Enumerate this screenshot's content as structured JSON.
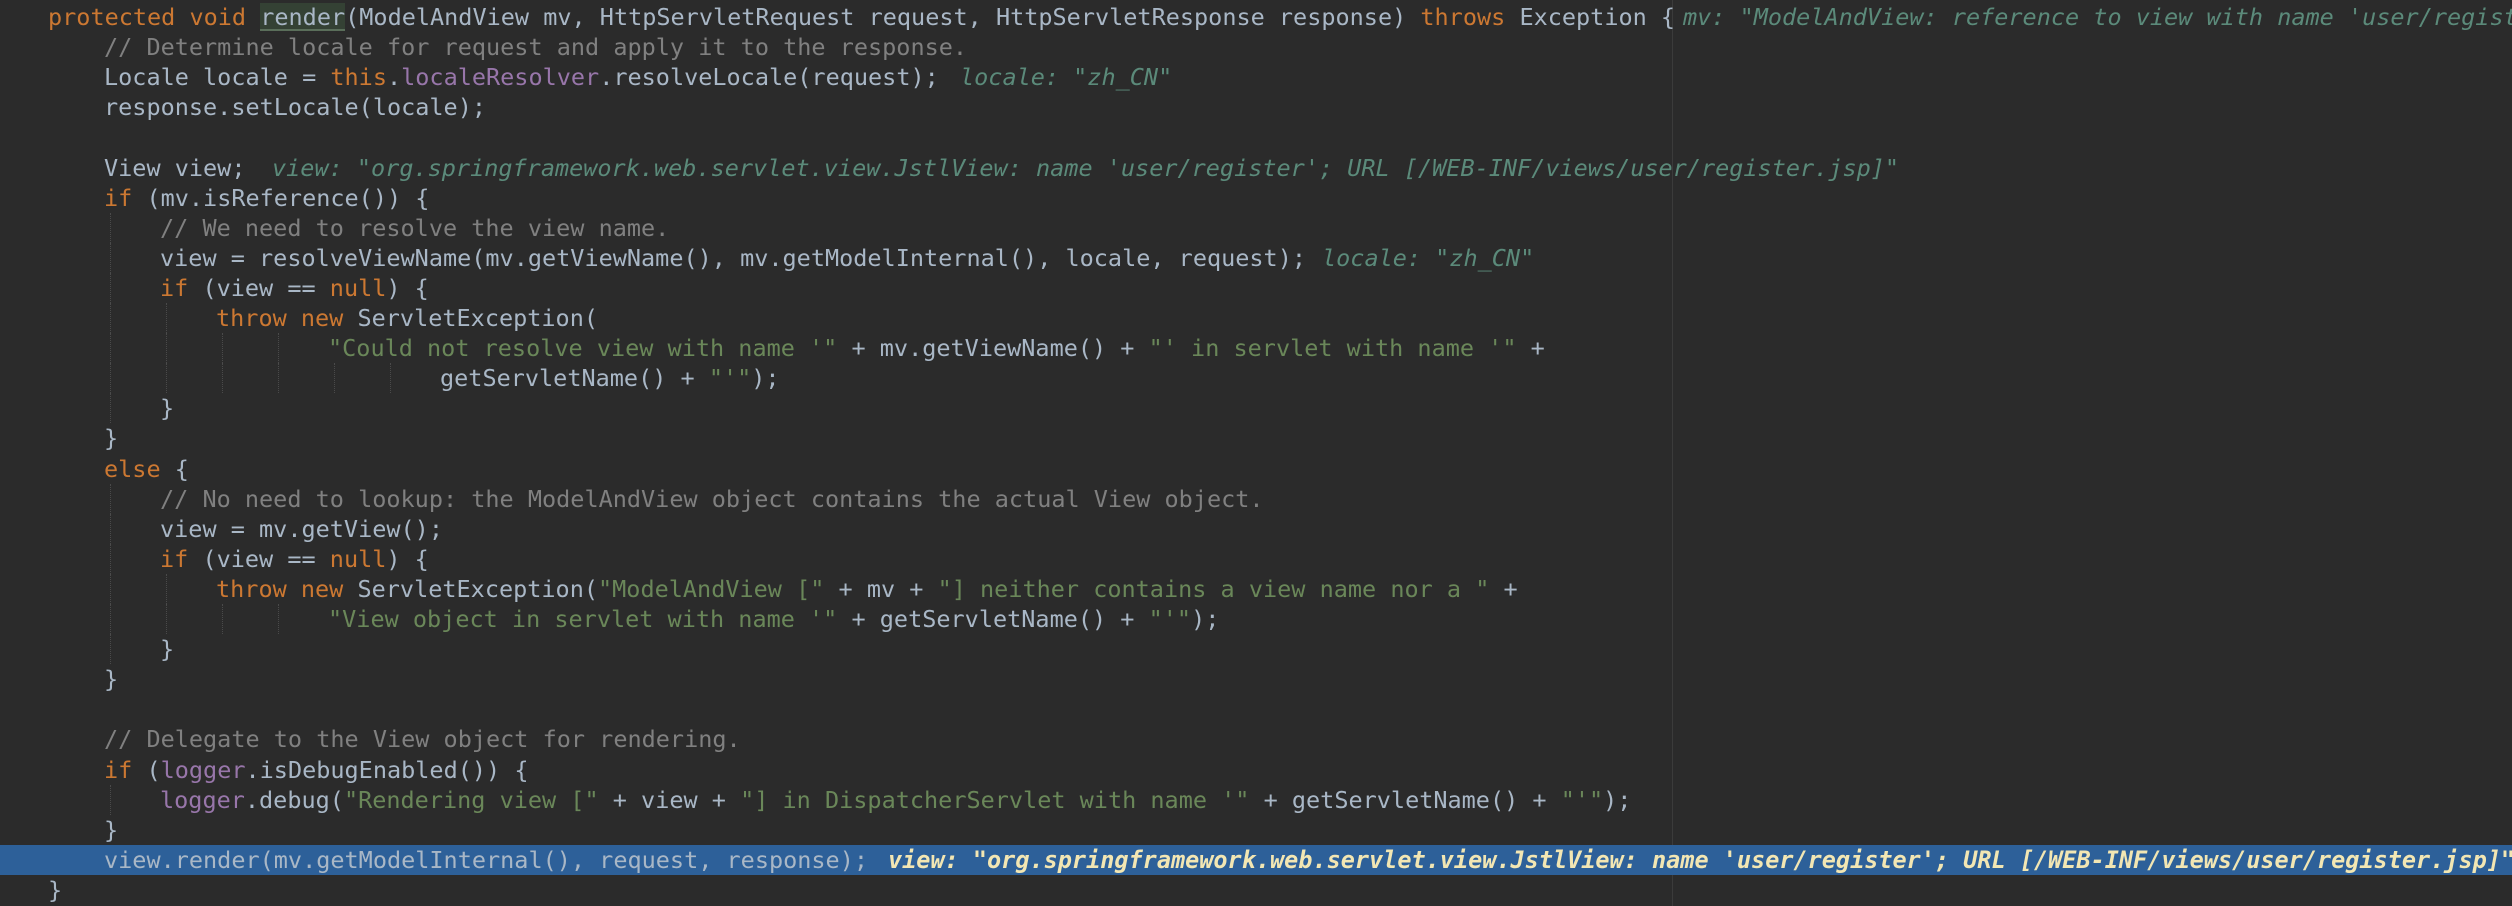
{
  "editor": {
    "lines": [
      {
        "id": "sig",
        "parts": [
          {
            "t": "kw",
            "v": "protected void "
          },
          {
            "t": "hl",
            "v": "render"
          },
          {
            "t": "",
            "v": "(ModelAndView mv, HttpServletRequest request, HttpServletResponse response) "
          },
          {
            "t": "kw",
            "v": "throws "
          },
          {
            "t": "",
            "v": "Exception {"
          }
        ],
        "hint": "mv: \"ModelAndView: reference to view with name 'user/regist"
      },
      {
        "id": "c1",
        "parts": [
          {
            "t": "cm",
            "v": "// Determine locale for request and apply it to the response."
          }
        ]
      },
      {
        "id": "l2",
        "parts": [
          {
            "t": "",
            "v": "Locale locale = "
          },
          {
            "t": "kw",
            "v": "this"
          },
          {
            "t": "",
            "v": "."
          },
          {
            "t": "fld",
            "v": "localeResolver"
          },
          {
            "t": "",
            "v": ".resolveLocale(request);"
          }
        ],
        "hint": "locale: \"zh_CN\""
      },
      {
        "id": "l3",
        "parts": [
          {
            "t": "",
            "v": "response.setLocale(locale);"
          }
        ]
      },
      {
        "id": "blank1",
        "parts": []
      },
      {
        "id": "l5",
        "parts": [
          {
            "t": "",
            "v": "View view;"
          }
        ],
        "hint": "view: \"org.springframework.web.servlet.view.JstlView: name 'user/register'; URL [/WEB-INF/views/user/register.jsp]\""
      },
      {
        "id": "l6",
        "parts": [
          {
            "t": "kw",
            "v": "if "
          },
          {
            "t": "",
            "v": "(mv.isReference()) {"
          }
        ]
      },
      {
        "id": "c7",
        "parts": [
          {
            "t": "cm",
            "v": "// We need to resolve the view name."
          }
        ]
      },
      {
        "id": "l8",
        "parts": [
          {
            "t": "",
            "v": "view = resolveViewName(mv.getViewName(), mv.getModelInternal(), locale, request);"
          }
        ],
        "hint": "locale: \"zh_CN\""
      },
      {
        "id": "l9",
        "parts": [
          {
            "t": "kw",
            "v": "if "
          },
          {
            "t": "",
            "v": "(view == "
          },
          {
            "t": "kw",
            "v": "null"
          },
          {
            "t": "",
            "v": ") {"
          }
        ]
      },
      {
        "id": "l10",
        "parts": [
          {
            "t": "kw",
            "v": "throw new "
          },
          {
            "t": "",
            "v": "ServletException("
          }
        ]
      },
      {
        "id": "l11",
        "parts": [
          {
            "t": "str",
            "v": "\"Could not resolve view with name '\""
          },
          {
            "t": "",
            "v": " + mv.getViewName() + "
          },
          {
            "t": "str",
            "v": "\"' in servlet with name '\""
          },
          {
            "t": "",
            "v": " +"
          }
        ]
      },
      {
        "id": "l12",
        "parts": [
          {
            "t": "",
            "v": "getServletName() + "
          },
          {
            "t": "str",
            "v": "\"'\""
          },
          {
            "t": "",
            "v": ");"
          }
        ]
      },
      {
        "id": "l13",
        "parts": [
          {
            "t": "",
            "v": "}"
          }
        ]
      },
      {
        "id": "l14",
        "parts": [
          {
            "t": "",
            "v": "}"
          }
        ]
      },
      {
        "id": "l15",
        "parts": [
          {
            "t": "kw",
            "v": "else "
          },
          {
            "t": "",
            "v": "{"
          }
        ]
      },
      {
        "id": "c16",
        "parts": [
          {
            "t": "cm",
            "v": "// No need to lookup: the ModelAndView object contains the actual View object."
          }
        ]
      },
      {
        "id": "l17",
        "parts": [
          {
            "t": "",
            "v": "view = mv.getView();"
          }
        ]
      },
      {
        "id": "l18",
        "parts": [
          {
            "t": "kw",
            "v": "if "
          },
          {
            "t": "",
            "v": "(view == "
          },
          {
            "t": "kw",
            "v": "null"
          },
          {
            "t": "",
            "v": ") {"
          }
        ]
      },
      {
        "id": "l19",
        "parts": [
          {
            "t": "kw",
            "v": "throw new "
          },
          {
            "t": "",
            "v": "ServletException("
          },
          {
            "t": "str",
            "v": "\"ModelAndView [\""
          },
          {
            "t": "",
            "v": " + mv + "
          },
          {
            "t": "str",
            "v": "\"] neither contains a view name nor a \""
          },
          {
            "t": "",
            "v": " +"
          }
        ]
      },
      {
        "id": "l20",
        "parts": [
          {
            "t": "str",
            "v": "\"View object in servlet with name '\""
          },
          {
            "t": "",
            "v": " + getServletName() + "
          },
          {
            "t": "str",
            "v": "\"'\""
          },
          {
            "t": "",
            "v": ");"
          }
        ]
      },
      {
        "id": "l21",
        "parts": [
          {
            "t": "",
            "v": "}"
          }
        ]
      },
      {
        "id": "l22",
        "parts": [
          {
            "t": "",
            "v": "}"
          }
        ]
      },
      {
        "id": "blank2",
        "parts": []
      },
      {
        "id": "c24",
        "parts": [
          {
            "t": "cm",
            "v": "// Delegate to the View object for rendering."
          }
        ]
      },
      {
        "id": "l25",
        "parts": [
          {
            "t": "kw",
            "v": "if "
          },
          {
            "t": "",
            "v": "("
          },
          {
            "t": "fld",
            "v": "logger"
          },
          {
            "t": "",
            "v": ".isDebugEnabled()) {"
          }
        ]
      },
      {
        "id": "l26",
        "parts": [
          {
            "t": "fld",
            "v": "logger"
          },
          {
            "t": "",
            "v": ".debug("
          },
          {
            "t": "str",
            "v": "\"Rendering view [\""
          },
          {
            "t": "",
            "v": " + view + "
          },
          {
            "t": "str",
            "v": "\"] in DispatcherServlet with name '\""
          },
          {
            "t": "",
            "v": " + getServletName() + "
          },
          {
            "t": "str",
            "v": "\"'\""
          },
          {
            "t": "",
            "v": ");"
          }
        ]
      },
      {
        "id": "l27",
        "parts": [
          {
            "t": "",
            "v": "}"
          }
        ]
      },
      {
        "id": "l28",
        "parts": [
          {
            "t": "",
            "v": "view.render(mv.getModelInternal(), request, response);"
          }
        ],
        "hint": "view: \"org.springframework.web.servlet.view.JstlView: name 'user/register'; URL [/WEB-INF/views/user/register.jsp]\""
      },
      {
        "id": "l29",
        "parts": [
          {
            "t": "",
            "v": "}"
          }
        ]
      }
    ]
  },
  "colors": {
    "background": "#2b2b2b",
    "keyword": "#cc7832",
    "comment": "#808080",
    "string": "#6a8759",
    "field": "#9876aa",
    "execution_line": "#2d6099",
    "inline_hint": "#5b8a7a"
  }
}
